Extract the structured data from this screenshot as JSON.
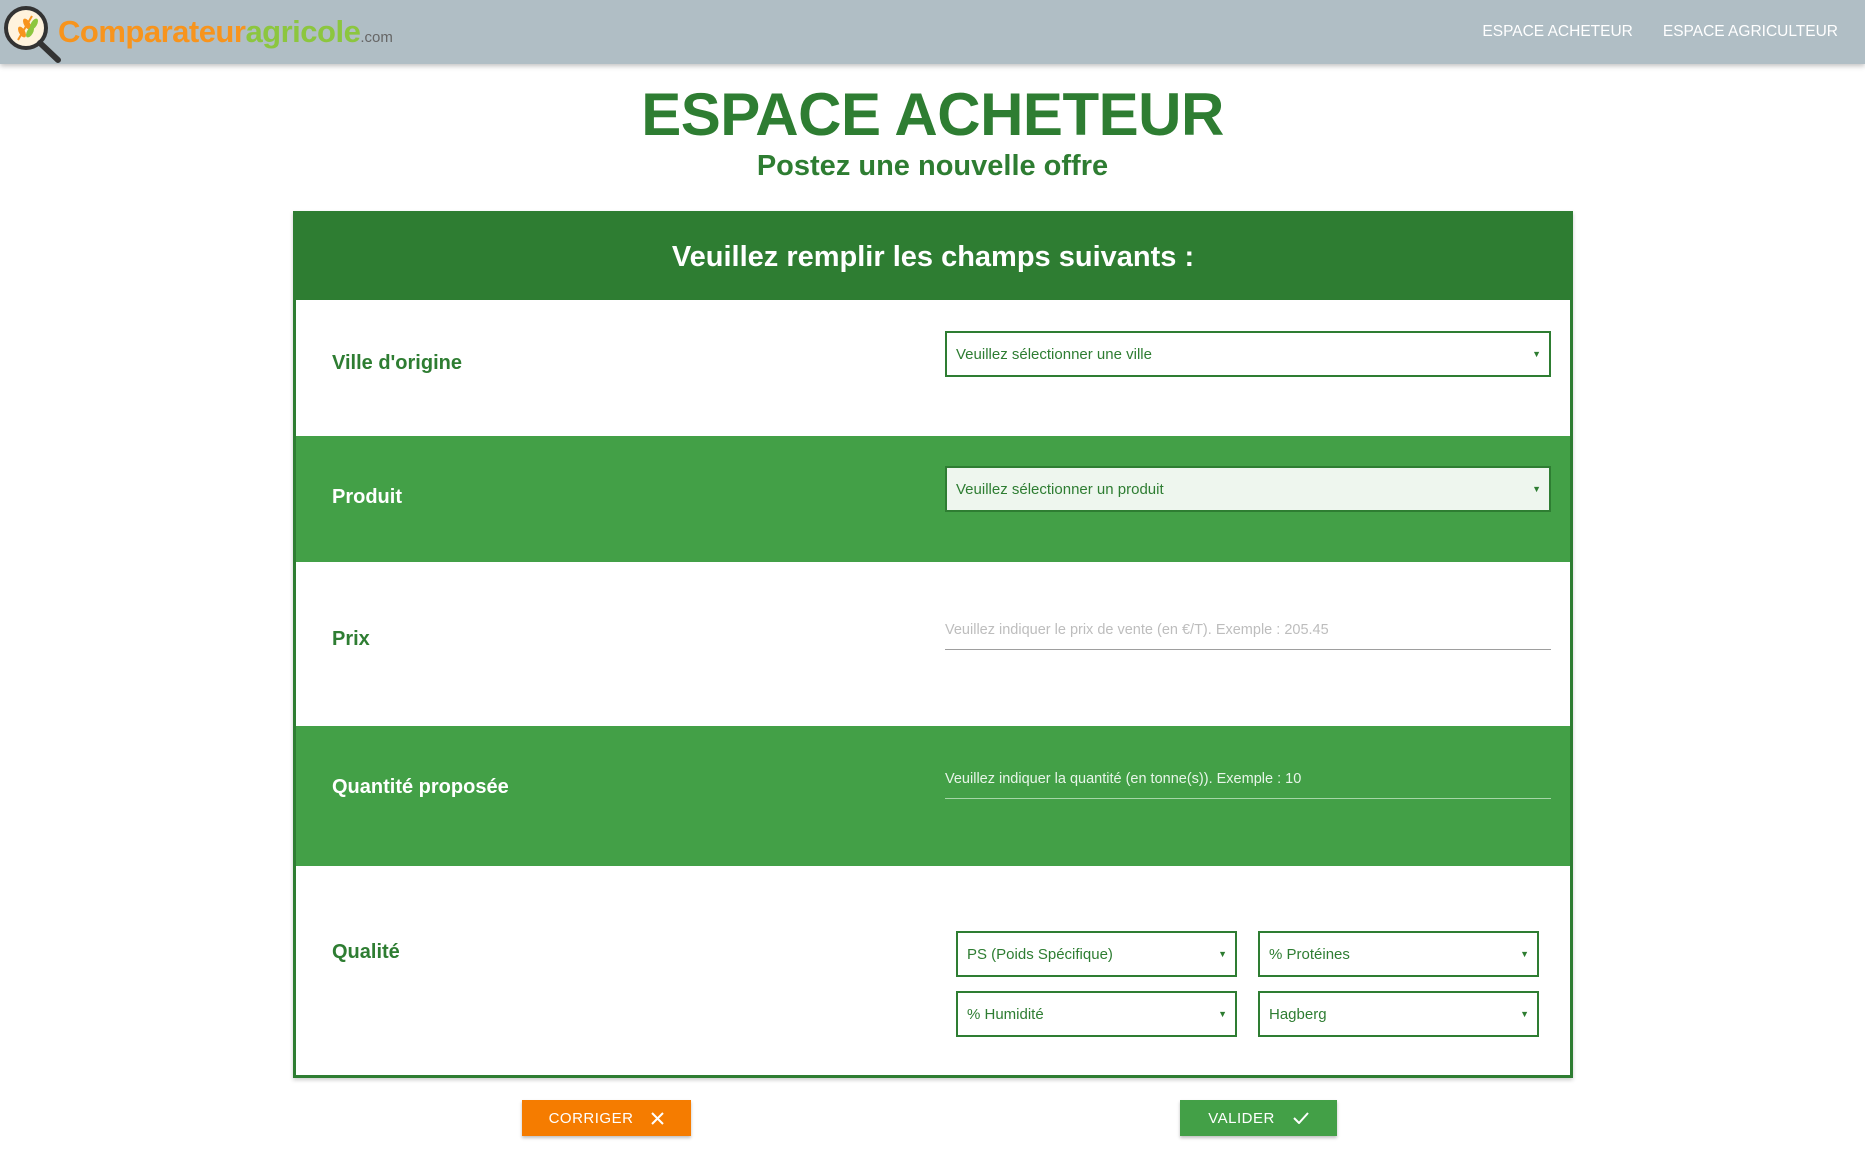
{
  "brand": {
    "part1": "Comparateur",
    "part2": "agricole",
    "suffix": ".com"
  },
  "nav": {
    "buyer_space": "ESPACE ACHETEUR",
    "farmer_space": "ESPACE AGRICULTEUR"
  },
  "page": {
    "title": "ESPACE ACHETEUR",
    "subtitle": "Postez une nouvelle offre"
  },
  "form": {
    "header": "Veuillez remplir les champs suivants :",
    "city": {
      "label": "Ville d'origine",
      "value": "Veuillez sélectionner une ville"
    },
    "product": {
      "label": "Produit",
      "value": "Veuillez sélectionner un produit"
    },
    "price": {
      "label": "Prix",
      "placeholder": "Veuillez indiquer le prix de vente (en €/T). Exemple : 205.45"
    },
    "quantity": {
      "label": "Quantité proposée",
      "placeholder": "Veuillez indiquer la quantité (en tonne(s)). Exemple : 10"
    },
    "quality": {
      "label": "Qualité",
      "ps": "PS (Poids Spécifique)",
      "proteins": "% Protéines",
      "humidity": "% Humidité",
      "hagberg": "Hagberg"
    }
  },
  "buttons": {
    "reset": "CORRIGER",
    "submit": "VALIDER"
  },
  "colors": {
    "primary_dark": "#2e7d32",
    "primary": "#43a047",
    "accent": "#f57c00",
    "navbar": "#b0bec5"
  },
  "icons": {
    "logo": "magnifier-wheat-logo",
    "reset": "close-icon",
    "submit": "check-icon",
    "dropdown": "caret-down-icon"
  }
}
